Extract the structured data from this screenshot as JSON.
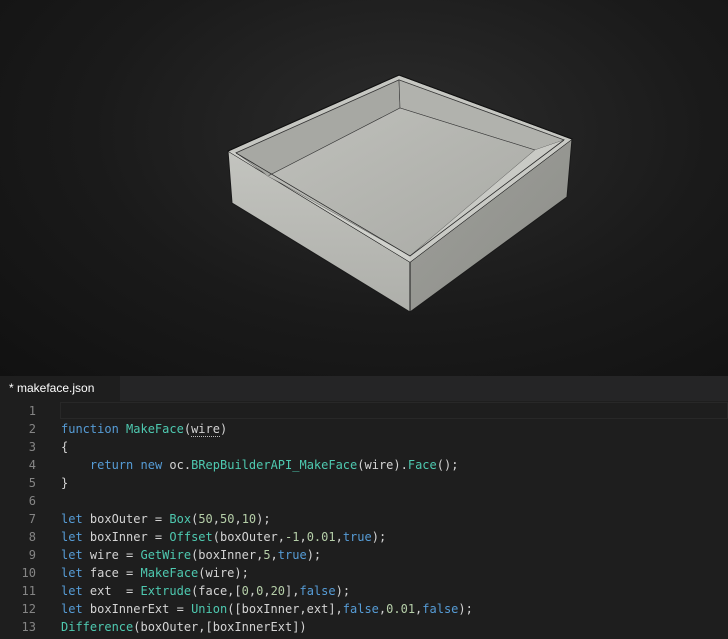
{
  "viewport": {
    "description_icon": "3d-model-view",
    "background_color": "#1c1c1c",
    "model_color": "#c9cac4"
  },
  "editor": {
    "tab_label": "* makeface.json",
    "lines": [
      {
        "num": "1",
        "tokens": []
      },
      {
        "num": "2",
        "tokens": [
          {
            "t": "function",
            "c": "kw"
          },
          {
            "t": " ",
            "c": "pl"
          },
          {
            "t": "MakeFace",
            "c": "fn"
          },
          {
            "t": "(",
            "c": "pl"
          },
          {
            "t": "wire",
            "c": "ident",
            "squiggle": true
          },
          {
            "t": ")",
            "c": "pl"
          }
        ]
      },
      {
        "num": "3",
        "tokens": [
          {
            "t": "{",
            "c": "pl"
          }
        ]
      },
      {
        "num": "4",
        "tokens": [
          {
            "t": "    ",
            "c": "pl"
          },
          {
            "t": "return",
            "c": "kw"
          },
          {
            "t": " ",
            "c": "pl"
          },
          {
            "t": "new",
            "c": "kw"
          },
          {
            "t": " oc.",
            "c": "pl"
          },
          {
            "t": "BRepBuilderAPI_MakeFace",
            "c": "fn"
          },
          {
            "t": "(wire).",
            "c": "pl"
          },
          {
            "t": "Face",
            "c": "fn"
          },
          {
            "t": "();",
            "c": "pl"
          }
        ]
      },
      {
        "num": "5",
        "tokens": [
          {
            "t": "}",
            "c": "pl"
          }
        ]
      },
      {
        "num": "6",
        "tokens": []
      },
      {
        "num": "7",
        "tokens": [
          {
            "t": "let",
            "c": "kw"
          },
          {
            "t": " boxOuter = ",
            "c": "pl"
          },
          {
            "t": "Box",
            "c": "fn"
          },
          {
            "t": "(",
            "c": "pl"
          },
          {
            "t": "50",
            "c": "num"
          },
          {
            "t": ",",
            "c": "pl"
          },
          {
            "t": "50",
            "c": "num"
          },
          {
            "t": ",",
            "c": "pl"
          },
          {
            "t": "10",
            "c": "num"
          },
          {
            "t": ");",
            "c": "pl"
          }
        ]
      },
      {
        "num": "8",
        "tokens": [
          {
            "t": "let",
            "c": "kw"
          },
          {
            "t": " boxInner = ",
            "c": "pl"
          },
          {
            "t": "Offset",
            "c": "fn"
          },
          {
            "t": "(boxOuter,",
            "c": "pl"
          },
          {
            "t": "-1",
            "c": "num"
          },
          {
            "t": ",",
            "c": "pl"
          },
          {
            "t": "0.01",
            "c": "num"
          },
          {
            "t": ",",
            "c": "pl"
          },
          {
            "t": "true",
            "c": "kw"
          },
          {
            "t": ");",
            "c": "pl"
          }
        ]
      },
      {
        "num": "9",
        "tokens": [
          {
            "t": "let",
            "c": "kw"
          },
          {
            "t": " wire = ",
            "c": "pl"
          },
          {
            "t": "GetWire",
            "c": "fn"
          },
          {
            "t": "(boxInner,",
            "c": "pl"
          },
          {
            "t": "5",
            "c": "num"
          },
          {
            "t": ",",
            "c": "pl"
          },
          {
            "t": "true",
            "c": "kw"
          },
          {
            "t": ");",
            "c": "pl"
          }
        ]
      },
      {
        "num": "10",
        "tokens": [
          {
            "t": "let",
            "c": "kw"
          },
          {
            "t": " face = ",
            "c": "pl"
          },
          {
            "t": "MakeFace",
            "c": "fn"
          },
          {
            "t": "(wire);",
            "c": "pl"
          }
        ]
      },
      {
        "num": "11",
        "tokens": [
          {
            "t": "let",
            "c": "kw"
          },
          {
            "t": " ext  = ",
            "c": "pl"
          },
          {
            "t": "Extrude",
            "c": "fn"
          },
          {
            "t": "(face,[",
            "c": "pl"
          },
          {
            "t": "0",
            "c": "num"
          },
          {
            "t": ",",
            "c": "pl"
          },
          {
            "t": "0",
            "c": "num"
          },
          {
            "t": ",",
            "c": "pl"
          },
          {
            "t": "20",
            "c": "num"
          },
          {
            "t": "],",
            "c": "pl"
          },
          {
            "t": "false",
            "c": "kw"
          },
          {
            "t": ");",
            "c": "pl"
          }
        ]
      },
      {
        "num": "12",
        "tokens": [
          {
            "t": "let",
            "c": "kw"
          },
          {
            "t": " boxInnerExt = ",
            "c": "pl"
          },
          {
            "t": "Union",
            "c": "fn"
          },
          {
            "t": "([boxInner,ext],",
            "c": "pl"
          },
          {
            "t": "false",
            "c": "kw"
          },
          {
            "t": ",",
            "c": "pl"
          },
          {
            "t": "0.01",
            "c": "num"
          },
          {
            "t": ",",
            "c": "pl"
          },
          {
            "t": "false",
            "c": "kw"
          },
          {
            "t": ");",
            "c": "pl"
          }
        ]
      },
      {
        "num": "13",
        "tokens": [
          {
            "t": "Difference",
            "c": "fn"
          },
          {
            "t": "(boxOuter,[boxInnerExt])",
            "c": "pl"
          }
        ]
      }
    ]
  }
}
